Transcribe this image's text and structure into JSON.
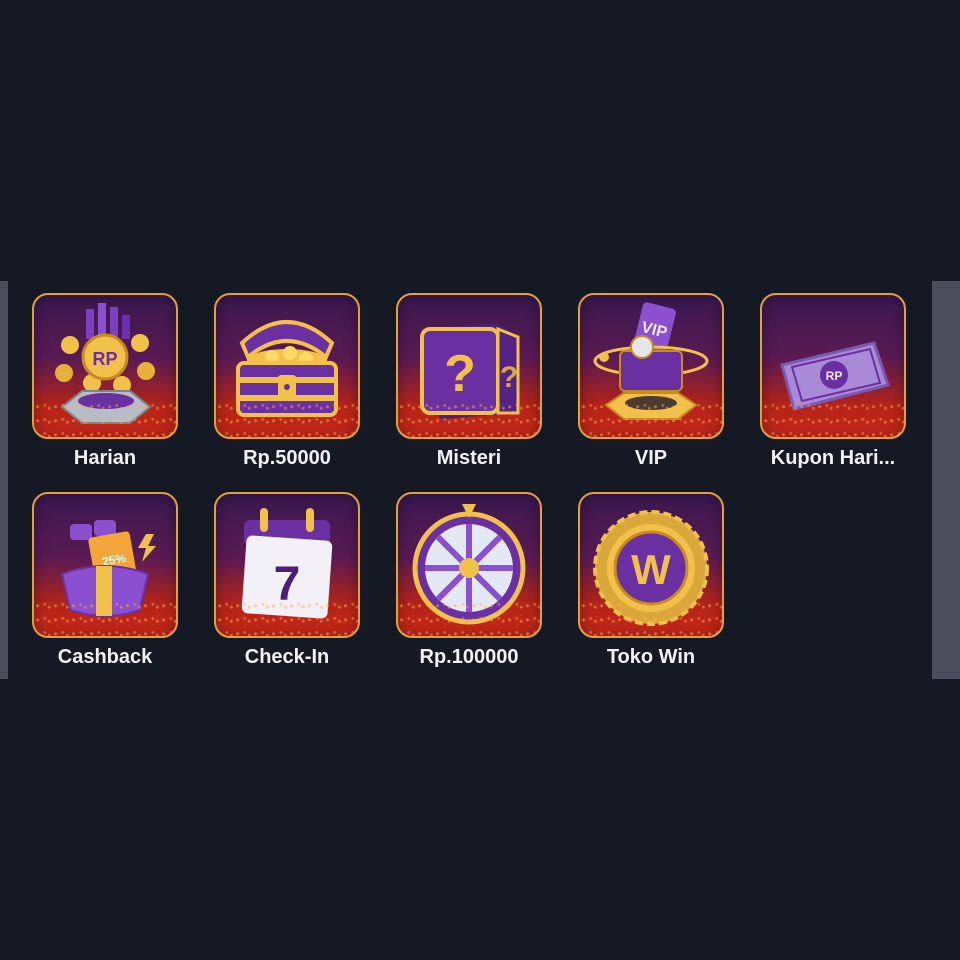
{
  "rewards": {
    "items": [
      {
        "label": "Harian",
        "icon": "rp-coin-fountain-icon"
      },
      {
        "label": "Rp.50000",
        "icon": "treasure-chest-icon"
      },
      {
        "label": "Misteri",
        "icon": "mystery-box-icon"
      },
      {
        "label": "VIP",
        "icon": "vip-gift-box-icon"
      },
      {
        "label": "Kupon Hari...",
        "icon": "rp-coupon-icon"
      },
      {
        "label": "Cashback",
        "icon": "cashback-gift-icon"
      },
      {
        "label": "Check-In",
        "icon": "calendar-checkin-icon"
      },
      {
        "label": "Rp.100000",
        "icon": "prize-wheel-icon"
      },
      {
        "label": "Toko Win",
        "icon": "win-badge-icon"
      }
    ]
  },
  "colors": {
    "background": "#151924",
    "card_border": "#e0a03c",
    "purple": "#6a2fa0",
    "gold": "#f2c14a",
    "label_text": "#f2f2f4"
  }
}
